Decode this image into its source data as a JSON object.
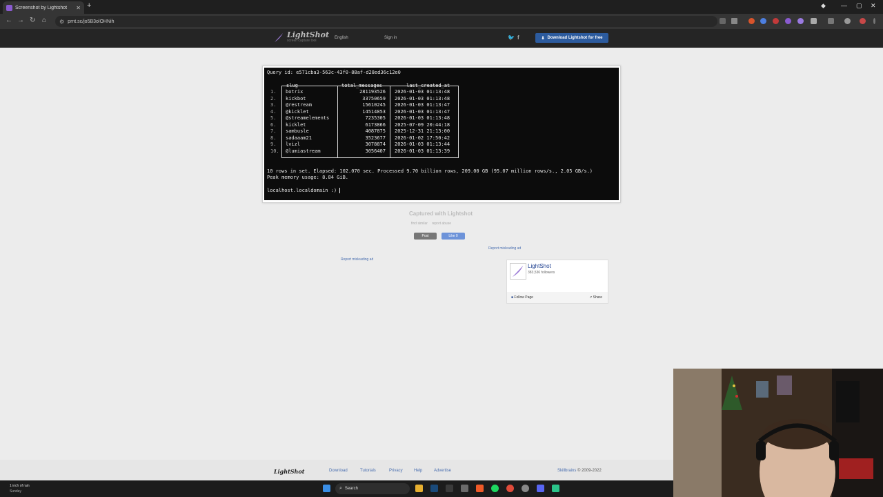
{
  "browser": {
    "tab_title": "Screenshot by Lightshot",
    "url": "prnt.sc/jo5B3olOHNih"
  },
  "header": {
    "brand": "LightShot",
    "tagline": "screen capture tool",
    "language": "English",
    "signin": "Sign in",
    "download_btn": "Download Lightshot for free"
  },
  "terminal": {
    "query_line": "Query id: e571cba3-563c-43f0-88af-d28ed36c12e0",
    "headers": [
      "slug",
      "total_messages",
      "last_created_at"
    ],
    "rows": [
      {
        "n": "1.",
        "slug": "botrix",
        "total": "281193526",
        "last": "2026-01-03 01:13:48"
      },
      {
        "n": "2.",
        "slug": "kickbot",
        "total": "33750659",
        "last": "2026-01-03 01:13:48"
      },
      {
        "n": "3.",
        "slug": "@restream",
        "total": "15610245",
        "last": "2026-01-03 01:13:47"
      },
      {
        "n": "4.",
        "slug": "@kicklet",
        "total": "14514853",
        "last": "2026-01-03 01:13:47"
      },
      {
        "n": "5.",
        "slug": "@streamelements",
        "total": "7235305",
        "last": "2026-01-03 01:13:48"
      },
      {
        "n": "6.",
        "slug": "kicklet",
        "total": "6173866",
        "last": "2025-07-09 20:44:18"
      },
      {
        "n": "7.",
        "slug": "sambusle",
        "total": "4087875",
        "last": "2025-12-31 21:13:00"
      },
      {
        "n": "8.",
        "slug": "sadaaam21",
        "total": "3523677",
        "last": "2026-01-02 17:50:42"
      },
      {
        "n": "9.",
        "slug": "lvizl",
        "total": "3078874",
        "last": "2026-01-03 01:13:44"
      },
      {
        "n": "10.",
        "slug": "@lumiastream",
        "total": "3056407",
        "last": "2026-01-03 01:13:39"
      }
    ],
    "summary": "10 rows in set. Elapsed: 102.070 sec. Processed 9.70 billion rows, 209.00 GB (95.07 million rows/s., 2.05 GB/s.)",
    "memory": "Peak memory usage: 8.84 GiB.",
    "prompt": "localhost.localdomain :) "
  },
  "below": {
    "captured": "Captured with Lightshot",
    "find_similar": "find similar",
    "report_abuse": "report abuse",
    "post": "Post",
    "like": "Like 0",
    "report_ad": "Report misleading ad"
  },
  "fb": {
    "name": "LightShot",
    "followers": "383,536 followers",
    "follow": "Follow Page",
    "share": "Share"
  },
  "footer": {
    "logo": "LightShot",
    "links": [
      "Download",
      "Tutorials",
      "Privacy",
      "Help",
      "Advertise"
    ],
    "company": "Skillbrains",
    "copyright": " © 2009-2022"
  },
  "taskbar": {
    "weather": "1 inch of rain",
    "weather_sub": "Sunday",
    "search": "Search"
  }
}
